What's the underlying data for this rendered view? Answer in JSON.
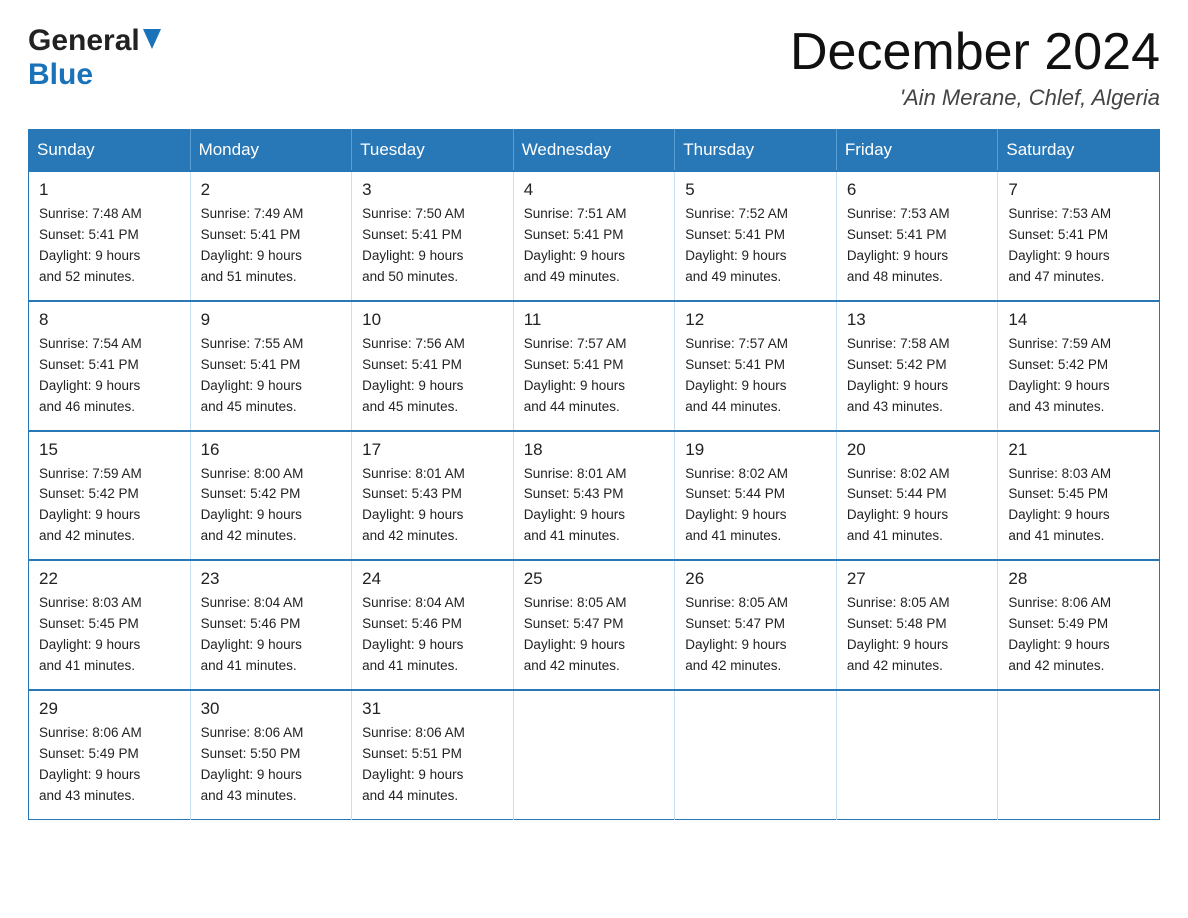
{
  "header": {
    "logo_general": "General",
    "logo_blue": "Blue",
    "month_title": "December 2024",
    "location": "'Ain Merane, Chlef, Algeria"
  },
  "weekdays": [
    "Sunday",
    "Monday",
    "Tuesday",
    "Wednesday",
    "Thursday",
    "Friday",
    "Saturday"
  ],
  "weeks": [
    [
      {
        "day": "1",
        "sunrise": "7:48 AM",
        "sunset": "5:41 PM",
        "daylight": "9 hours and 52 minutes."
      },
      {
        "day": "2",
        "sunrise": "7:49 AM",
        "sunset": "5:41 PM",
        "daylight": "9 hours and 51 minutes."
      },
      {
        "day": "3",
        "sunrise": "7:50 AM",
        "sunset": "5:41 PM",
        "daylight": "9 hours and 50 minutes."
      },
      {
        "day": "4",
        "sunrise": "7:51 AM",
        "sunset": "5:41 PM",
        "daylight": "9 hours and 49 minutes."
      },
      {
        "day": "5",
        "sunrise": "7:52 AM",
        "sunset": "5:41 PM",
        "daylight": "9 hours and 49 minutes."
      },
      {
        "day": "6",
        "sunrise": "7:53 AM",
        "sunset": "5:41 PM",
        "daylight": "9 hours and 48 minutes."
      },
      {
        "day": "7",
        "sunrise": "7:53 AM",
        "sunset": "5:41 PM",
        "daylight": "9 hours and 47 minutes."
      }
    ],
    [
      {
        "day": "8",
        "sunrise": "7:54 AM",
        "sunset": "5:41 PM",
        "daylight": "9 hours and 46 minutes."
      },
      {
        "day": "9",
        "sunrise": "7:55 AM",
        "sunset": "5:41 PM",
        "daylight": "9 hours and 45 minutes."
      },
      {
        "day": "10",
        "sunrise": "7:56 AM",
        "sunset": "5:41 PM",
        "daylight": "9 hours and 45 minutes."
      },
      {
        "day": "11",
        "sunrise": "7:57 AM",
        "sunset": "5:41 PM",
        "daylight": "9 hours and 44 minutes."
      },
      {
        "day": "12",
        "sunrise": "7:57 AM",
        "sunset": "5:41 PM",
        "daylight": "9 hours and 44 minutes."
      },
      {
        "day": "13",
        "sunrise": "7:58 AM",
        "sunset": "5:42 PM",
        "daylight": "9 hours and 43 minutes."
      },
      {
        "day": "14",
        "sunrise": "7:59 AM",
        "sunset": "5:42 PM",
        "daylight": "9 hours and 43 minutes."
      }
    ],
    [
      {
        "day": "15",
        "sunrise": "7:59 AM",
        "sunset": "5:42 PM",
        "daylight": "9 hours and 42 minutes."
      },
      {
        "day": "16",
        "sunrise": "8:00 AM",
        "sunset": "5:42 PM",
        "daylight": "9 hours and 42 minutes."
      },
      {
        "day": "17",
        "sunrise": "8:01 AM",
        "sunset": "5:43 PM",
        "daylight": "9 hours and 42 minutes."
      },
      {
        "day": "18",
        "sunrise": "8:01 AM",
        "sunset": "5:43 PM",
        "daylight": "9 hours and 41 minutes."
      },
      {
        "day": "19",
        "sunrise": "8:02 AM",
        "sunset": "5:44 PM",
        "daylight": "9 hours and 41 minutes."
      },
      {
        "day": "20",
        "sunrise": "8:02 AM",
        "sunset": "5:44 PM",
        "daylight": "9 hours and 41 minutes."
      },
      {
        "day": "21",
        "sunrise": "8:03 AM",
        "sunset": "5:45 PM",
        "daylight": "9 hours and 41 minutes."
      }
    ],
    [
      {
        "day": "22",
        "sunrise": "8:03 AM",
        "sunset": "5:45 PM",
        "daylight": "9 hours and 41 minutes."
      },
      {
        "day": "23",
        "sunrise": "8:04 AM",
        "sunset": "5:46 PM",
        "daylight": "9 hours and 41 minutes."
      },
      {
        "day": "24",
        "sunrise": "8:04 AM",
        "sunset": "5:46 PM",
        "daylight": "9 hours and 41 minutes."
      },
      {
        "day": "25",
        "sunrise": "8:05 AM",
        "sunset": "5:47 PM",
        "daylight": "9 hours and 42 minutes."
      },
      {
        "day": "26",
        "sunrise": "8:05 AM",
        "sunset": "5:47 PM",
        "daylight": "9 hours and 42 minutes."
      },
      {
        "day": "27",
        "sunrise": "8:05 AM",
        "sunset": "5:48 PM",
        "daylight": "9 hours and 42 minutes."
      },
      {
        "day": "28",
        "sunrise": "8:06 AM",
        "sunset": "5:49 PM",
        "daylight": "9 hours and 42 minutes."
      }
    ],
    [
      {
        "day": "29",
        "sunrise": "8:06 AM",
        "sunset": "5:49 PM",
        "daylight": "9 hours and 43 minutes."
      },
      {
        "day": "30",
        "sunrise": "8:06 AM",
        "sunset": "5:50 PM",
        "daylight": "9 hours and 43 minutes."
      },
      {
        "day": "31",
        "sunrise": "8:06 AM",
        "sunset": "5:51 PM",
        "daylight": "9 hours and 44 minutes."
      },
      null,
      null,
      null,
      null
    ]
  ],
  "labels": {
    "sunrise": "Sunrise:",
    "sunset": "Sunset:",
    "daylight": "Daylight:"
  }
}
